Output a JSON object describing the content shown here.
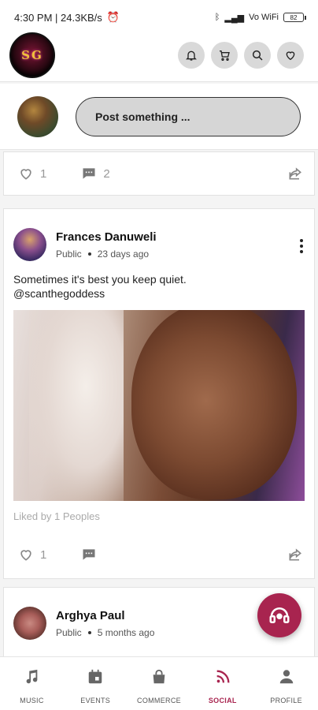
{
  "status_bar": {
    "time_speed": "4:30 PM | 24.3KB/s",
    "network": "Vo WiFi",
    "battery": "82"
  },
  "header": {
    "logo_text": "SG"
  },
  "composer": {
    "placeholder": "Post something ..."
  },
  "top_post_actions": {
    "likes": "1",
    "comments": "2"
  },
  "post": {
    "author": "Frances Danuweli",
    "visibility": "Public",
    "time": "23 days ago",
    "text_line1": "Sometimes it's best you keep quiet.",
    "text_line2": "@scanthegoddess",
    "liked_by": "Liked by 1 Peoples",
    "likes": "1"
  },
  "next_post": {
    "author": "Arghya  Paul",
    "visibility": "Public",
    "time": "5 months ago"
  },
  "nav": {
    "items": [
      {
        "label": "MUSIC"
      },
      {
        "label": "EVENTS"
      },
      {
        "label": "COMMERCE"
      },
      {
        "label": "SOCIAL"
      },
      {
        "label": "PROFILE"
      }
    ]
  },
  "colors": {
    "accent": "#a8244f",
    "icon_gray": "#999999"
  }
}
